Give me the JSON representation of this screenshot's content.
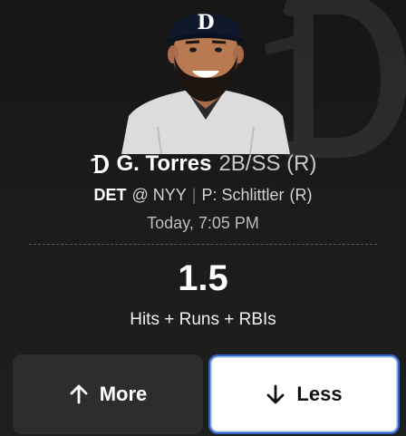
{
  "player": {
    "name": "G. Torres",
    "position": "2B/SS (R)",
    "team_icon": "tigers-d-logo-icon",
    "photo_icon": "player-headshot"
  },
  "matchup": {
    "team": "DET",
    "opponent": "@ NYY",
    "separator": "|",
    "pitcher": "P: Schlittler",
    "pitcher_hand": "(R)"
  },
  "game_time": "Today, 7:05 PM",
  "projection": {
    "line": "1.5",
    "stat": "Hits + Runs + RBIs"
  },
  "actions": {
    "more_label": "More",
    "more_icon": "arrow-up-icon",
    "less_label": "Less",
    "less_icon": "arrow-down-icon"
  },
  "colors": {
    "background": "#1a1a1a",
    "more_button_bg": "#2d2d2d",
    "less_button_bg": "#ffffff",
    "selected_border": "#2f63c6"
  }
}
